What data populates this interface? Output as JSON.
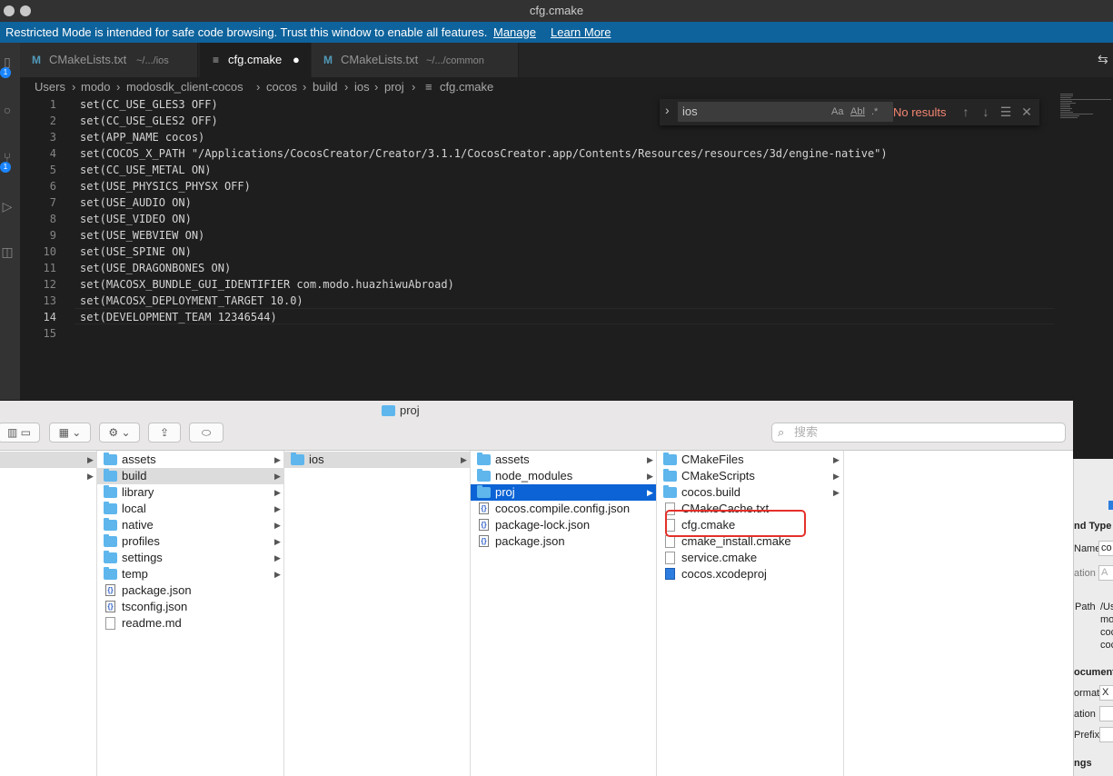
{
  "window": {
    "title": "cfg.cmake"
  },
  "banner": {
    "message": "Restricted Mode is intended for safe code browsing. Trust this window to enable all features.",
    "manage": "Manage",
    "learn_more": "Learn More"
  },
  "activity": {
    "badges": [
      "1",
      "1"
    ]
  },
  "tabs": [
    {
      "icon": "M",
      "name": "CMakeLists.txt",
      "path": "~/.../ios"
    },
    {
      "icon": "≡",
      "name": "cfg.cmake",
      "modified": "●"
    },
    {
      "icon": "M",
      "name": "CMakeLists.txt",
      "path": "~/.../common"
    }
  ],
  "breadcrumb": [
    "Users",
    "modo",
    "modosdk_client-cocos",
    "cocos",
    "build",
    "ios",
    "proj",
    "cfg.cmake"
  ],
  "editor": {
    "lines": [
      {
        "n": "1",
        "text": "set(CC_USE_GLES3 OFF)"
      },
      {
        "n": "2",
        "text": "set(CC_USE_GLES2 OFF)"
      },
      {
        "n": "3",
        "text": "set(APP_NAME cocos)"
      },
      {
        "n": "4",
        "text": "set(COCOS_X_PATH \"/Applications/CocosCreator/Creator/3.1.1/CocosCreator.app/Contents/Resources/resources/3d/engine-native\")"
      },
      {
        "n": "5",
        "text": "set(CC_USE_METAL ON)"
      },
      {
        "n": "6",
        "text": "set(USE_PHYSICS_PHYSX OFF)"
      },
      {
        "n": "7",
        "text": "set(USE_AUDIO ON)"
      },
      {
        "n": "8",
        "text": "set(USE_VIDEO ON)"
      },
      {
        "n": "9",
        "text": "set(USE_WEBVIEW ON)"
      },
      {
        "n": "10",
        "text": "set(USE_SPINE ON)"
      },
      {
        "n": "11",
        "text": "set(USE_DRAGONBONES ON)"
      },
      {
        "n": "12",
        "text": "set(MACOSX_BUNDLE_GUI_IDENTIFIER com.modo.huazhiwuAbroad)"
      },
      {
        "n": "13",
        "text": "set(MACOSX_DEPLOYMENT_TARGET 10.0)"
      },
      {
        "n": "14",
        "text": "set(DEVELOPMENT_TEAM 12346544)"
      },
      {
        "n": "15",
        "text": ""
      }
    ]
  },
  "find": {
    "value": "ios",
    "opt_case": "Aa",
    "opt_word": "Abl",
    "opt_regex": ".*",
    "status": "No results"
  },
  "finder": {
    "title": "proj",
    "search_placeholder": "搜索",
    "col1": [
      {
        "arrow": "▶"
      },
      {
        "arrow": "▶"
      }
    ],
    "col2": [
      {
        "type": "folder",
        "name": "assets",
        "arrow": "▶"
      },
      {
        "type": "folder",
        "name": "build",
        "arrow": "▶",
        "sel": true
      },
      {
        "type": "folder",
        "name": "library",
        "arrow": "▶"
      },
      {
        "type": "folder",
        "name": "local",
        "arrow": "▶"
      },
      {
        "type": "folder",
        "name": "native",
        "arrow": "▶"
      },
      {
        "type": "folder",
        "name": "profiles",
        "arrow": "▶"
      },
      {
        "type": "folder",
        "name": "settings",
        "arrow": "▶"
      },
      {
        "type": "folder",
        "name": "temp",
        "arrow": "▶"
      },
      {
        "type": "json",
        "name": "package.json"
      },
      {
        "type": "json",
        "name": "tsconfig.json"
      },
      {
        "type": "doc",
        "name": "readme.md"
      }
    ],
    "col3": [
      {
        "type": "folder",
        "name": "ios",
        "arrow": "▶",
        "sel": true
      }
    ],
    "col4": [
      {
        "type": "folder",
        "name": "assets",
        "arrow": "▶"
      },
      {
        "type": "folder",
        "name": "node_modules",
        "arrow": "▶"
      },
      {
        "type": "folder",
        "name": "proj",
        "arrow": "▶",
        "hi": true
      },
      {
        "type": "json",
        "name": "cocos.compile.config.json"
      },
      {
        "type": "json",
        "name": "package-lock.json"
      },
      {
        "type": "json",
        "name": "package.json"
      }
    ],
    "col5": [
      {
        "type": "folder",
        "name": "CMakeFiles",
        "arrow": "▶"
      },
      {
        "type": "folder",
        "name": "CMakeScripts",
        "arrow": "▶"
      },
      {
        "type": "folder",
        "name": "cocos.build",
        "arrow": "▶"
      },
      {
        "type": "doc",
        "name": "CMakeCache.txt"
      },
      {
        "type": "doc",
        "name": "cfg.cmake"
      },
      {
        "type": "doc",
        "name": "cmake_install.cmake"
      },
      {
        "type": "doc",
        "name": "service.cmake"
      },
      {
        "type": "xcode",
        "name": "cocos.xcodeproj"
      }
    ]
  },
  "inspector": {
    "type_header": "nd Type",
    "name_label": "Name",
    "name_value": "co",
    "location_label": "ation",
    "location_value": "A",
    "path_label": "Path",
    "path_lines": [
      "/Us",
      "mo",
      "coc",
      "coc"
    ],
    "doc_header": "ocument",
    "format_label": "ormat",
    "format_value": "X",
    "ation2_label": "ation",
    "prefix_label": "Prefix",
    "settings_header": "ngs"
  },
  "colors": {
    "accent_blue": "#0e639c",
    "selection": "#0b63d5",
    "highlight_red": "#e5302a",
    "no_results": "#f48771"
  }
}
